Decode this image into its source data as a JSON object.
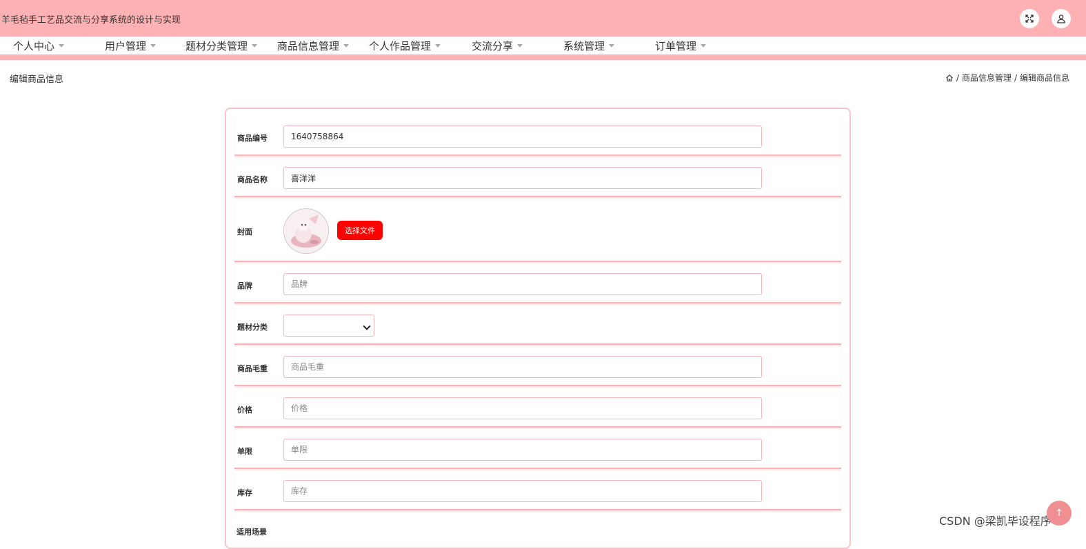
{
  "header": {
    "app_title": "羊毛毡手工艺品交流与分享系统的设计与实现",
    "fullscreen_icon": "expand-icon",
    "user_icon": "user-icon",
    "bg_color": "#ffb1b4"
  },
  "nav": {
    "items": [
      {
        "label": "个人中心"
      },
      {
        "label": "用户管理"
      },
      {
        "label": "题材分类管理"
      },
      {
        "label": "商品信息管理"
      },
      {
        "label": "个人作品管理"
      },
      {
        "label": "交流分享"
      },
      {
        "label": "系统管理"
      },
      {
        "label": "订单管理"
      }
    ]
  },
  "page": {
    "title": "编辑商品信息",
    "breadcrumb": [
      "商品信息管理",
      "编辑商品信息"
    ],
    "separator": "/"
  },
  "form": {
    "fields": {
      "code": {
        "label": "商品编号",
        "value": "1640758864",
        "placeholder": ""
      },
      "name": {
        "label": "商品名称",
        "value": "喜洋洋",
        "placeholder": ""
      },
      "cover": {
        "label": "封面",
        "button": "选择文件"
      },
      "brand": {
        "label": "品牌",
        "value": "",
        "placeholder": "品牌"
      },
      "category": {
        "label": "题材分类",
        "value": ""
      },
      "weight": {
        "label": "商品毛重",
        "value": "",
        "placeholder": "商品毛重"
      },
      "price": {
        "label": "价格",
        "value": "",
        "placeholder": "价格"
      },
      "limit": {
        "label": "单限",
        "value": "",
        "placeholder": "单限"
      },
      "stock": {
        "label": "库存",
        "value": "",
        "placeholder": "库存"
      },
      "scene": {
        "label": "适用场景"
      }
    },
    "accent_color": "#ff0000",
    "border_color": "#f7b3b6"
  },
  "watermark": "CSDN @梁凯毕设程序",
  "scroll_top_icon": "arrow-up-icon"
}
